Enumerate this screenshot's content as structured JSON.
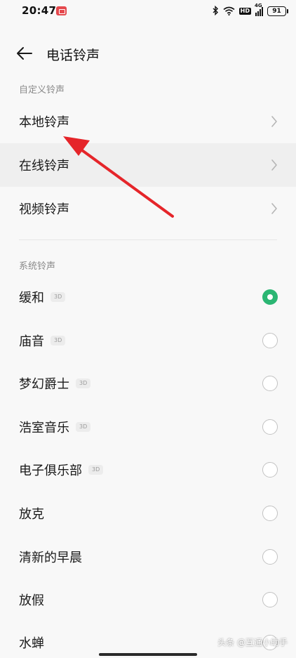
{
  "status_bar": {
    "time": "20:47",
    "bluetooth_icon": "bluetooth-icon",
    "wifi_icon": "wifi-icon",
    "hd_label": "HD",
    "network_label": "4G",
    "battery_level": "91"
  },
  "header": {
    "title": "电话铃声",
    "back_icon": "arrow-left-icon"
  },
  "custom_section": {
    "label": "自定义铃声",
    "items": [
      {
        "label": "本地铃声"
      },
      {
        "label": "在线铃声"
      },
      {
        "label": "视频铃声"
      }
    ]
  },
  "system_section": {
    "label": "系统铃声",
    "items": [
      {
        "label": "缓和",
        "badge": "3D",
        "selected": true
      },
      {
        "label": "庙音",
        "badge": "3D",
        "selected": false
      },
      {
        "label": "梦幻爵士",
        "badge": "3D",
        "selected": false
      },
      {
        "label": "浩室音乐",
        "badge": "3D",
        "selected": false
      },
      {
        "label": "电子俱乐部",
        "badge": "3D",
        "selected": false
      },
      {
        "label": "放克",
        "selected": false
      },
      {
        "label": "清新的早晨",
        "selected": false
      },
      {
        "label": "放假",
        "selected": false
      },
      {
        "label": "水蝉",
        "selected": false
      }
    ]
  },
  "watermark": "头条 @互通小助手",
  "colors": {
    "background": "#f8f8f8",
    "selected_radio": "#2bb673",
    "annotation_arrow": "#e5252a",
    "pressed_row": "#efefef"
  }
}
